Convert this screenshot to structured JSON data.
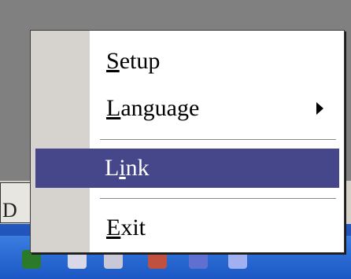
{
  "menu": {
    "items": [
      {
        "label": "Setup",
        "mnemonic": "S"
      },
      {
        "label": "Language",
        "mnemonic": "L",
        "has_submenu": true
      },
      {
        "label": "Link",
        "mnemonic": "i",
        "highlighted": true
      },
      {
        "label": "Exit",
        "mnemonic": "E"
      }
    ]
  },
  "icons": {
    "submenu": "submenu-arrow-icon"
  },
  "colors": {
    "highlight": "#46468a",
    "menu_bg": "#ffffff",
    "strip": "#d6d3ce",
    "taskbar": "#1a49b0"
  }
}
